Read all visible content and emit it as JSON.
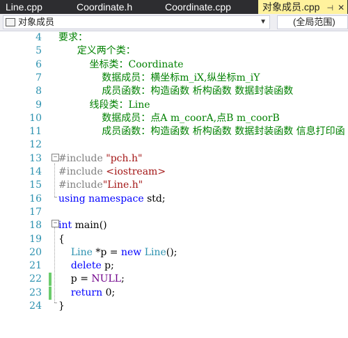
{
  "tabs": [
    {
      "label": "Line.cpp",
      "active": false
    },
    {
      "label": "Coordinate.h",
      "active": false
    },
    {
      "label": "Coordinate.cpp",
      "active": false
    },
    {
      "label": "对象成员.cpp",
      "active": true
    }
  ],
  "tab_pin_icon": "pin-icon",
  "tab_close_icon": "close-icon",
  "nav": {
    "project": "对象成员",
    "scope": "(全局范围)"
  },
  "lines": [
    {
      "num": "4",
      "tokens": [
        {
          "c": "cm",
          "t": "要求："
        }
      ]
    },
    {
      "num": "5",
      "tokens": [
        {
          "c": "cm",
          "t": "      定义两个类："
        }
      ]
    },
    {
      "num": "6",
      "tokens": [
        {
          "c": "cm",
          "t": "          坐标类：Coordinate"
        }
      ]
    },
    {
      "num": "7",
      "tokens": [
        {
          "c": "cm",
          "t": "              数据成员：横坐标m_iX,纵坐标m_iY"
        }
      ]
    },
    {
      "num": "8",
      "tokens": [
        {
          "c": "cm",
          "t": "              成员函数：构造函数 析构函数 数据封装函数"
        }
      ]
    },
    {
      "num": "9",
      "tokens": [
        {
          "c": "cm",
          "t": "          线段类：Line"
        }
      ]
    },
    {
      "num": "10",
      "tokens": [
        {
          "c": "cm",
          "t": "              数据成员：点A m_coorA,点B m_coorB"
        }
      ]
    },
    {
      "num": "11",
      "tokens": [
        {
          "c": "cm",
          "t": "              成员函数：构造函数 析构函数 数据封装函数 信息打印函"
        }
      ]
    },
    {
      "num": "12",
      "tokens": []
    },
    {
      "num": "13",
      "tokens": [
        {
          "c": "pp",
          "t": "#include "
        },
        {
          "c": "str",
          "t": "\"pch.h\""
        }
      ]
    },
    {
      "num": "14",
      "tokens": [
        {
          "c": "pp",
          "t": "#include "
        },
        {
          "c": "str",
          "t": "<iostream>"
        }
      ]
    },
    {
      "num": "15",
      "tokens": [
        {
          "c": "pp",
          "t": "#include"
        },
        {
          "c": "str",
          "t": "\"Line.h\""
        }
      ]
    },
    {
      "num": "16",
      "tokens": [
        {
          "c": "kw",
          "t": "using namespace"
        },
        {
          "c": "",
          "t": " std;"
        }
      ]
    },
    {
      "num": "17",
      "tokens": []
    },
    {
      "num": "18",
      "tokens": [
        {
          "c": "kw",
          "t": "int"
        },
        {
          "c": "",
          "t": " main()"
        }
      ]
    },
    {
      "num": "19",
      "tokens": [
        {
          "c": "",
          "t": "{"
        }
      ]
    },
    {
      "num": "20",
      "tokens": [
        {
          "c": "",
          "t": "    "
        },
        {
          "c": "ty",
          "t": "Line"
        },
        {
          "c": "",
          "t": " *p = "
        },
        {
          "c": "kw",
          "t": "new"
        },
        {
          "c": "",
          "t": " "
        },
        {
          "c": "ty",
          "t": "Line"
        },
        {
          "c": "",
          "t": "();"
        }
      ]
    },
    {
      "num": "21",
      "tokens": [
        {
          "c": "",
          "t": "    "
        },
        {
          "c": "kw",
          "t": "delete"
        },
        {
          "c": "",
          "t": " p;"
        }
      ]
    },
    {
      "num": "22",
      "tokens": [
        {
          "c": "",
          "t": "    p = "
        },
        {
          "c": "mac",
          "t": "NULL"
        },
        {
          "c": "",
          "t": ";"
        }
      ]
    },
    {
      "num": "23",
      "tokens": [
        {
          "c": "",
          "t": "    "
        },
        {
          "c": "kw",
          "t": "return"
        },
        {
          "c": "",
          "t": " 0;"
        }
      ]
    },
    {
      "num": "24",
      "tokens": [
        {
          "c": "",
          "t": "}"
        }
      ]
    }
  ]
}
